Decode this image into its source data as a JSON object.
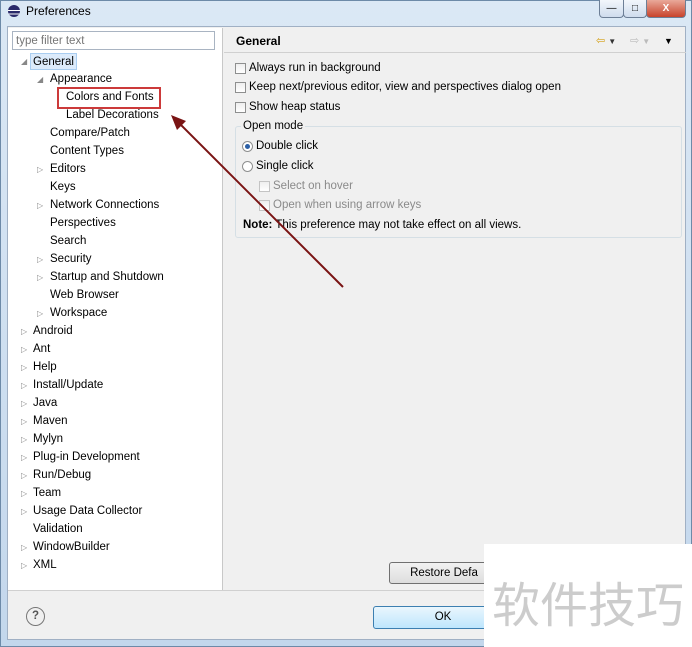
{
  "window": {
    "title": "Preferences",
    "minimize": "—",
    "maximize": "□",
    "close": "X"
  },
  "filter": {
    "placeholder": "type filter text"
  },
  "tree": [
    {
      "label": "General",
      "level": 0,
      "arrow": "open",
      "selected": true
    },
    {
      "label": "Appearance",
      "level": 1,
      "arrow": "open"
    },
    {
      "label": "Colors and Fonts",
      "level": 2,
      "arrow": "none",
      "highlighted": true
    },
    {
      "label": "Label Decorations",
      "level": 2,
      "arrow": "none"
    },
    {
      "label": "Compare/Patch",
      "level": 1,
      "arrow": "none"
    },
    {
      "label": "Content Types",
      "level": 1,
      "arrow": "none"
    },
    {
      "label": "Editors",
      "level": 1,
      "arrow": "closed"
    },
    {
      "label": "Keys",
      "level": 1,
      "arrow": "none"
    },
    {
      "label": "Network Connections",
      "level": 1,
      "arrow": "closed"
    },
    {
      "label": "Perspectives",
      "level": 1,
      "arrow": "none"
    },
    {
      "label": "Search",
      "level": 1,
      "arrow": "none"
    },
    {
      "label": "Security",
      "level": 1,
      "arrow": "closed"
    },
    {
      "label": "Startup and Shutdown",
      "level": 1,
      "arrow": "closed"
    },
    {
      "label": "Web Browser",
      "level": 1,
      "arrow": "none"
    },
    {
      "label": "Workspace",
      "level": 1,
      "arrow": "closed"
    },
    {
      "label": "Android",
      "level": 0,
      "arrow": "closed"
    },
    {
      "label": "Ant",
      "level": 0,
      "arrow": "closed"
    },
    {
      "label": "Help",
      "level": 0,
      "arrow": "closed"
    },
    {
      "label": "Install/Update",
      "level": 0,
      "arrow": "closed"
    },
    {
      "label": "Java",
      "level": 0,
      "arrow": "closed"
    },
    {
      "label": "Maven",
      "level": 0,
      "arrow": "closed"
    },
    {
      "label": "Mylyn",
      "level": 0,
      "arrow": "closed"
    },
    {
      "label": "Plug-in Development",
      "level": 0,
      "arrow": "closed"
    },
    {
      "label": "Run/Debug",
      "level": 0,
      "arrow": "closed"
    },
    {
      "label": "Team",
      "level": 0,
      "arrow": "closed"
    },
    {
      "label": "Usage Data Collector",
      "level": 0,
      "arrow": "closed"
    },
    {
      "label": "Validation",
      "level": 0,
      "arrow": "none"
    },
    {
      "label": "WindowBuilder",
      "level": 0,
      "arrow": "closed"
    },
    {
      "label": "XML",
      "level": 0,
      "arrow": "closed"
    }
  ],
  "page": {
    "title": "General",
    "options": [
      {
        "label": "Always run in background",
        "checked": false
      },
      {
        "label": "Keep next/previous editor, view and perspectives dialog open",
        "checked": false
      },
      {
        "label": "Show heap status",
        "checked": false
      }
    ],
    "open_mode": {
      "label": "Open mode",
      "double_click": "Double click",
      "single_click": "Single click",
      "selected": "Double click",
      "select_on_hover": "Select on hover",
      "open_arrow_keys": "Open when using arrow keys"
    },
    "note_label": "Note:",
    "note_text": "This preference may not take effect on all views.",
    "restore_defaults": "Restore Defa"
  },
  "footer": {
    "ok": "OK",
    "help_icon": "?"
  },
  "watermark": "软件技巧",
  "colors": {
    "highlight_box": "#cc3a3a",
    "arrow": "#7a1414"
  }
}
